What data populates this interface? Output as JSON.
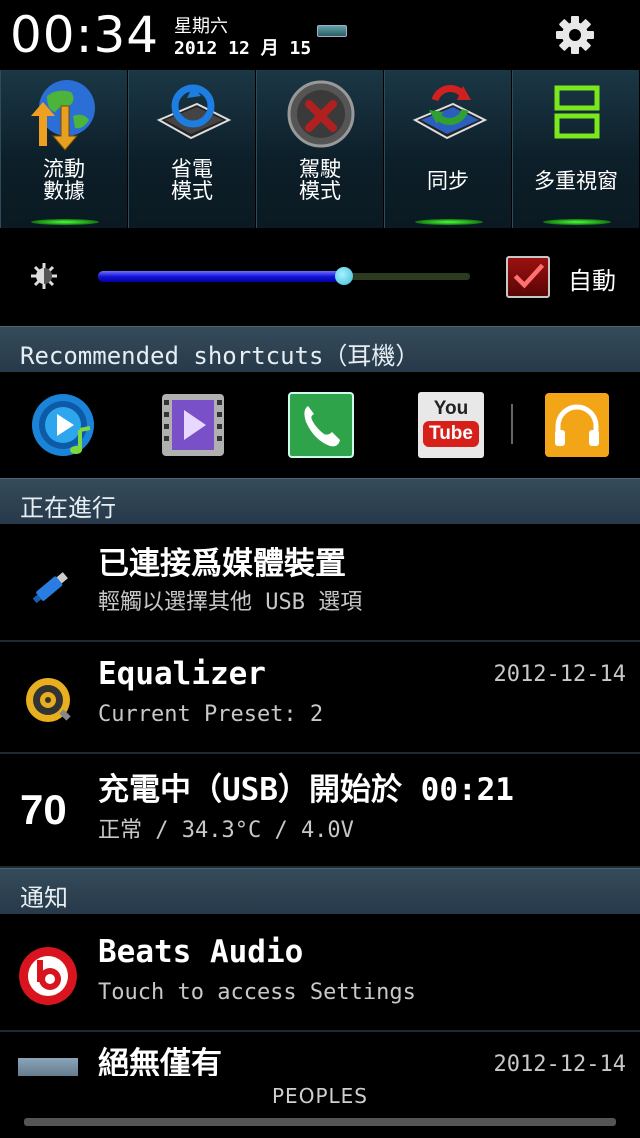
{
  "status": {
    "time": "00:34",
    "weekday": "星期六",
    "date": "2012 12 月 15"
  },
  "toggles": [
    {
      "label_line1": "流動",
      "label_line2": "數據",
      "icon": "globe-data-icon"
    },
    {
      "label_line1": "省電",
      "label_line2": "模式",
      "icon": "power-saving-icon"
    },
    {
      "label_line1": "駕駛",
      "label_line2": "模式",
      "icon": "driving-mode-icon"
    },
    {
      "label": "同步",
      "icon": "sync-icon"
    },
    {
      "label": "多重視窗",
      "icon": "multi-window-icon"
    }
  ],
  "brightness": {
    "level": 0.66,
    "auto_label": "自動",
    "auto_checked": true
  },
  "sections": {
    "recommended": "Recommended shortcuts（耳機）",
    "ongoing": "正在進行",
    "notifications": "通知"
  },
  "shortcuts": [
    {
      "name": "music-player-icon"
    },
    {
      "name": "video-player-icon"
    },
    {
      "name": "phone-icon"
    },
    {
      "name": "youtube-icon",
      "text1": "You",
      "text2": "Tube"
    },
    {
      "name": "headphones-icon"
    }
  ],
  "ongoing": [
    {
      "title": "已連接爲媒體裝置",
      "subtitle": "輕觸以選擇其他 USB 選項",
      "icon": "usb-icon"
    },
    {
      "title": "Equalizer",
      "subtitle": "Current Preset: 2",
      "timestamp": "2012-12-14",
      "icon": "equalizer-icon"
    },
    {
      "title": "充電中（USB）開始於 00:21",
      "subtitle": "正常 / 34.3°C / 4.0V",
      "badge": "70",
      "icon": "battery-level-icon"
    }
  ],
  "notifications": [
    {
      "title": "Beats Audio",
      "subtitle": "Touch to access Settings",
      "icon": "beats-audio-icon"
    },
    {
      "title": "絕無僅有",
      "timestamp": "2012-12-14",
      "icon": "album-art-icon"
    }
  ],
  "bottom": {
    "label": "PEOPLES"
  }
}
